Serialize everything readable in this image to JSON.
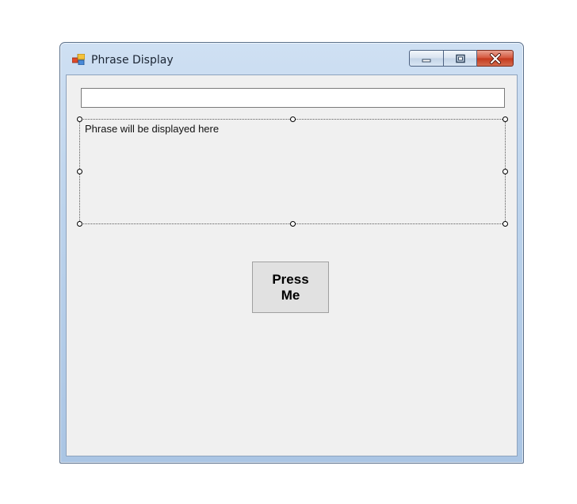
{
  "window": {
    "title": "Phrase Display",
    "controls": {
      "minimize_icon": "minimize-icon",
      "maximize_icon": "maximize-icon",
      "close_icon": "close-icon"
    }
  },
  "form": {
    "phrase_input_value": "",
    "phrase_label": "Phrase will be displayed here",
    "press_button_label": "Press\nMe"
  },
  "colors": {
    "client_background": "#f0f0f0",
    "close_button": "#c4381c",
    "title_bar": "#bcd3ec"
  }
}
